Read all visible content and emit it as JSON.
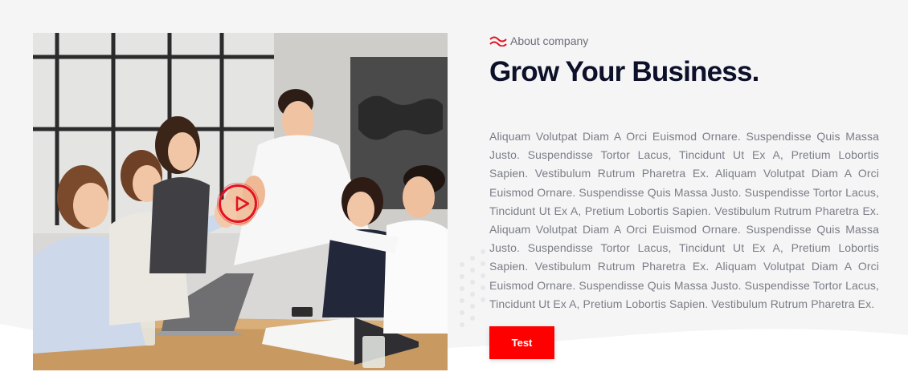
{
  "about": {
    "eyebrow_icon": "wave-icon",
    "eyebrow": "About company",
    "title": "Grow Your Business.",
    "body": "Aliquam Volutpat Diam A Orci Euismod Ornare. Suspendisse Quis Massa Justo. Suspendisse Tortor Lacus, Tincidunt Ut Ex A, Pretium Lobortis Sapien. Vestibulum Rutrum Pharetra Ex. Aliquam Volutpat Diam A Orci Euismod Ornare. Suspendisse Quis Massa Justo. Suspendisse Tortor Lacus, Tincidunt Ut Ex A, Pretium Lobortis Sapien. Vestibulum Rutrum Pharetra Ex. Aliquam Volutpat Diam A Orci Euismod Ornare. Suspendisse Quis Massa Justo. Suspendisse Tortor Lacus, Tincidunt Ut Ex A, Pretium Lobortis Sapien. Vestibulum Rutrum Pharetra Ex. Aliquam Volutpat Diam A Orci Euismod Ornare. Suspendisse Quis Massa Justo. Suspendisse Tortor Lacus, Tincidunt Ut Ex A, Pretium Lobortis Sapien. Vestibulum Rutrum Pharetra Ex.",
    "button_label": "Test"
  },
  "media": {
    "image_subject": "business team giving high five around office table",
    "play_icon": "play-icon"
  },
  "colors": {
    "accent": "#ff0000",
    "title": "#0c1029",
    "body": "#7a7d86",
    "background": "#f5f5f6"
  }
}
